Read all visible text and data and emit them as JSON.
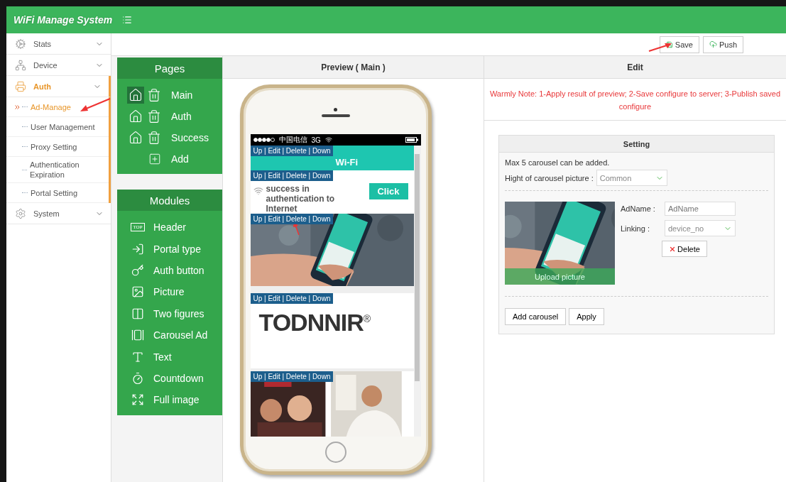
{
  "header": {
    "title": "WiFi Manage System"
  },
  "sidebar": {
    "items": [
      {
        "label": "Stats",
        "kind": "stats",
        "selected": false
      },
      {
        "label": "Device",
        "kind": "device",
        "selected": false
      },
      {
        "label": "Auth",
        "kind": "auth",
        "selected": true,
        "expanded": true,
        "children": [
          {
            "label": "Ad-Manage",
            "selected": true
          },
          {
            "label": "User Management",
            "selected": false
          },
          {
            "label": "Proxy Setting",
            "selected": false
          },
          {
            "label": "Authentication Expiration",
            "selected": false
          },
          {
            "label": "Portal Setting",
            "selected": false
          }
        ]
      },
      {
        "label": "System",
        "kind": "system",
        "selected": false
      }
    ]
  },
  "toolbar": {
    "buttons": [
      {
        "label": "Save",
        "kind": "save"
      },
      {
        "label": "Push",
        "kind": "push"
      }
    ]
  },
  "pages": {
    "title": "Pages",
    "items": [
      {
        "label": "Main",
        "selected": true
      },
      {
        "label": "Auth",
        "selected": false
      },
      {
        "label": "Success",
        "selected": false
      }
    ],
    "add_label": "Add"
  },
  "modules": {
    "title": "Modules",
    "items": [
      {
        "label": "Header",
        "kind": "header",
        "badge": "TOP"
      },
      {
        "label": "Portal type",
        "kind": "portal"
      },
      {
        "label": "Auth button",
        "kind": "key"
      },
      {
        "label": "Picture",
        "kind": "picture"
      },
      {
        "label": "Two figures",
        "kind": "two"
      },
      {
        "label": "Carousel Ad",
        "kind": "carousel"
      },
      {
        "label": "Text",
        "kind": "text"
      },
      {
        "label": "Countdown",
        "kind": "countdown"
      },
      {
        "label": "Full image",
        "kind": "full"
      }
    ]
  },
  "preview": {
    "title": "Preview ( Main )",
    "status_bar": {
      "carrier": "中国电信",
      "network": "3G"
    },
    "blocks": [
      {
        "kind": "header",
        "actions": "Up | Edit | Delete | Down",
        "title": "Wi-Fi"
      },
      {
        "kind": "auth",
        "actions": "Up | Edit | Delete | Down",
        "text": "success in authentication to Internet",
        "button": "Click"
      },
      {
        "kind": "carousel",
        "actions": "Up | Edit | Delete | Down"
      },
      {
        "kind": "logo",
        "actions": "Up | Edit | Delete | Down",
        "logo": "TODNNIR",
        "mark": "®"
      },
      {
        "kind": "two_figures",
        "actions": "Up | Edit | Delete | Down"
      }
    ]
  },
  "edit": {
    "title": "Edit",
    "note": "Warmly Note: 1-Apply result of preview; 2-Save configure to server; 3-Publish saved configure",
    "setting": {
      "title": "Setting",
      "limit_text": "Max 5 carousel can be added.",
      "height_label": "Hight of carousel picture :",
      "height_value": "Common",
      "carousels": [
        {
          "upload_label": "Upload picture",
          "name_label": "AdName :",
          "name_placeholder": "AdName",
          "link_label": "Linking :",
          "link_value": "device_no",
          "delete_label": "Delete"
        }
      ],
      "buttons": [
        "Add carousel",
        "Apply"
      ]
    }
  }
}
